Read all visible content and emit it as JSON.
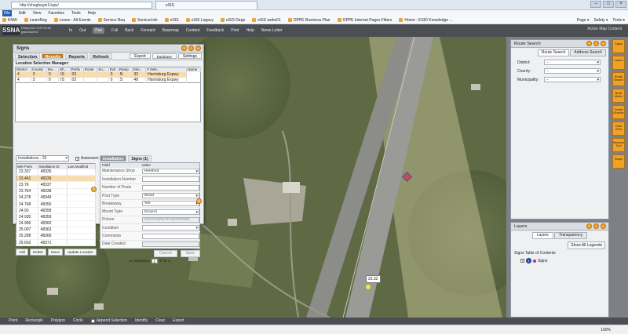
{
  "browser": {
    "url": "http://shagbegis1/sgis/",
    "tab_title": "eSIS",
    "menu": [
      "File",
      "Edit",
      "View",
      "Favorites",
      "Tools",
      "Help"
    ],
    "favorites": [
      "KNW",
      "LearnReg",
      "Leave - All Events",
      "Service Req",
      "ServiceLink",
      "eSIS",
      "eSIS Legacy",
      "eSIS Depp",
      "eSIS webs01",
      "OPPE Business Plan",
      "OPPE Internet Pages Filters",
      "Home - ESID Knowledge ..."
    ],
    "tools": [
      "Page ▾",
      "Safety ▾",
      "Tools ▾"
    ],
    "zoom": "100%"
  },
  "app": {
    "logo": "SSNA",
    "subtitle": "Enterprise GIS Portal gisbranch01",
    "toolbar": [
      "In",
      "Out",
      "Pan",
      "Full",
      "Back",
      "Forward",
      "Basemap",
      "Content",
      "Feedback",
      "Print",
      "Help",
      "News Letter"
    ],
    "active_tool": "Pan",
    "active_map": "Active Map Content"
  },
  "signs_panel": {
    "title": "Signs",
    "tabs": [
      "Selection",
      "Results",
      "Reports",
      "Refresh"
    ],
    "active_tab": "Results",
    "export_label": "Export",
    "database_label": "Database",
    "settings_label": "Settings",
    "location_manager": "Location Selection Manager:",
    "loc_columns": [
      "District",
      "County",
      "Mu...",
      "Sh...",
      "Prefix",
      "Route",
      "Su...",
      "Exit",
      "Ramp",
      "Dire...",
      "# Sele...",
      "Name"
    ],
    "loc_rows": [
      [
        "4",
        "3",
        "0",
        "IS",
        "03",
        "",
        "",
        "0",
        "N",
        "32",
        "Harrisburg Expwy"
      ],
      [
        "4",
        "3",
        "0",
        "IS",
        "03",
        "",
        "",
        "0",
        "S",
        "48",
        "Harrisburg Expwy"
      ]
    ],
    "installation_select": "Installations - 32",
    "autozoom_label": "Autozoom",
    "inst_columns": [
      "Mile Point",
      "Installation ID",
      "Last Modified"
    ],
    "inst_rows": [
      [
        "23.337",
        "48335",
        ""
      ],
      [
        "23.441",
        "48336",
        ""
      ],
      [
        "23.76",
        "48337",
        ""
      ],
      [
        "23.764",
        "48338",
        ""
      ],
      [
        "24.278",
        "48349",
        ""
      ],
      [
        "24.768",
        "48356",
        ""
      ],
      [
        "24.93",
        "48358",
        ""
      ],
      [
        "24.935",
        "48359",
        ""
      ],
      [
        "24.966",
        "48360",
        ""
      ],
      [
        "25.007",
        "48363",
        ""
      ],
      [
        "25.298",
        "48366",
        ""
      ],
      [
        "25.602",
        "48371",
        ""
      ]
    ],
    "inst_buttons": [
      "Add",
      "Delete",
      "Move",
      "Update Location"
    ],
    "form_tabs": [
      "Installation",
      "Signs (1)"
    ],
    "form_columns": [
      "Field",
      "Value"
    ],
    "form_rows": [
      {
        "field": "Maintenance Shop",
        "value": "Hereford",
        "dropdown": true,
        "disabled": false
      },
      {
        "field": "Installation Number",
        "value": "",
        "dropdown": false,
        "disabled": false
      },
      {
        "field": "Number of Posts",
        "value": "",
        "dropdown": false,
        "disabled": false
      },
      {
        "field": "Post Type",
        "value": "Wood",
        "dropdown": true,
        "disabled": false
      },
      {
        "field": "Breakaway",
        "value": "Yes",
        "dropdown": true,
        "disabled": false
      },
      {
        "field": "Mount Type",
        "value": "Ground",
        "dropdown": true,
        "disabled": false
      },
      {
        "field": "Picture",
        "value": "\\\\SHAHSI\\DATA\\SIGNTEM...",
        "dropdown": false,
        "disabled": true
      },
      {
        "field": "Condition",
        "value": "",
        "dropdown": true,
        "disabled": false
      },
      {
        "field": "Comments",
        "value": "",
        "dropdown": false,
        "disabled": false
      },
      {
        "field": "Date Created",
        "value": "",
        "dropdown": false,
        "disabled": true
      }
    ],
    "cancel_label": "Cancel",
    "save_label": "Save",
    "pager_label": "Installation",
    "pager_current": "2",
    "pager_total": "of 32"
  },
  "route_search": {
    "title": "Route Search",
    "tabs": [
      "Route Search",
      "Address Search"
    ],
    "fields": [
      {
        "label": "District:",
        "value": "--"
      },
      {
        "label": "County:",
        "value": "--"
      },
      {
        "label": "Municipality:",
        "value": "--"
      }
    ]
  },
  "layers": {
    "title": "Layers",
    "tabs": [
      "Layers",
      "Transparency"
    ],
    "show_all": "Show All Legends",
    "toc_title": "Signs Table of Contents",
    "layer_name": "Signs"
  },
  "side_buttons": [
    "Signs",
    "Layers",
    "Route Search",
    "Book Marks",
    "Create Graphic",
    "Grab Shot",
    "Measure Tool",
    "Swipe"
  ],
  "map": {
    "mile_label": "23.32"
  },
  "map_tools": [
    "Point",
    "Rectangle",
    "Polygon",
    "Circle",
    "Append Selection",
    "Identify",
    "Clear",
    "Export"
  ],
  "colors": {
    "accent": "#f0a126",
    "header": "#4b4f53",
    "selected_row": "#f6ddb0",
    "sign_point": "#b42aa8"
  }
}
